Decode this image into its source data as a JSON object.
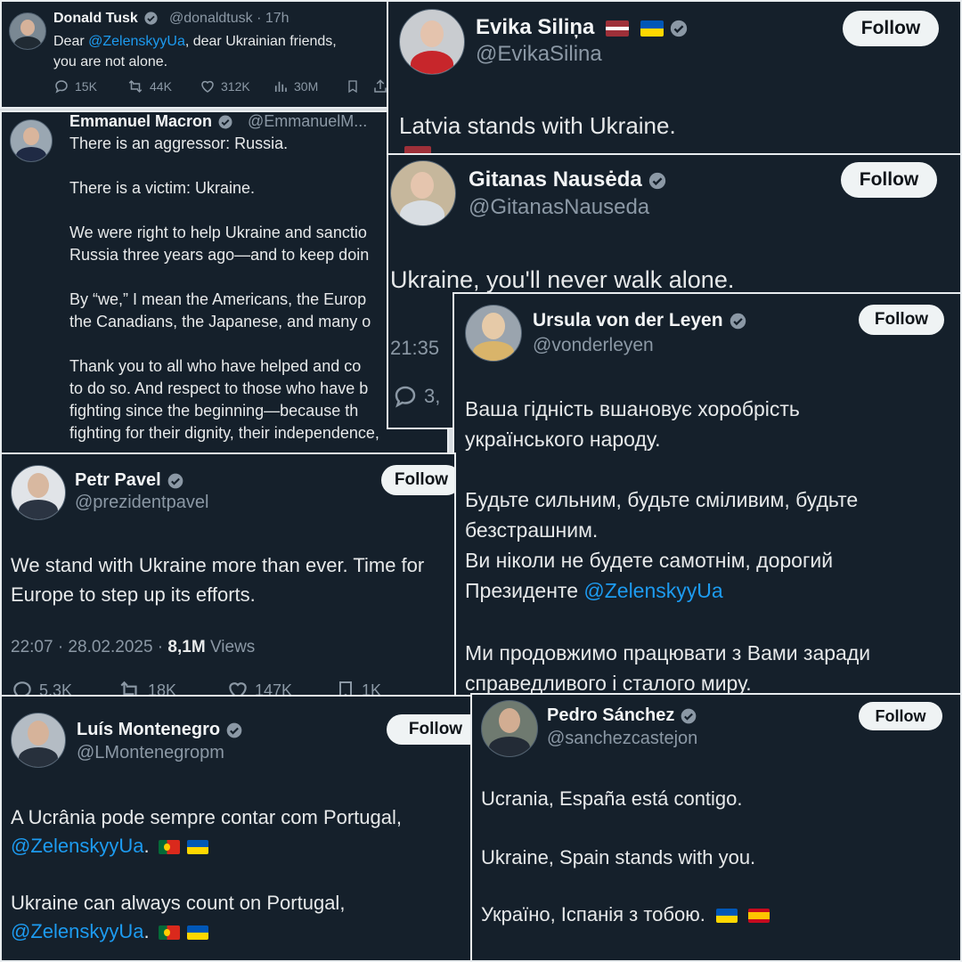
{
  "tusk": {
    "name": "Donald Tusk",
    "handle": "@donaldtusk · 17h",
    "text_before": "Dear ",
    "mention": "@ZelenskyyUa",
    "text_after": ", dear Ukrainian friends,\nyou are not alone.",
    "stats": {
      "replies": "15K",
      "reposts": "44K",
      "likes": "312K",
      "views": "30M"
    }
  },
  "silina": {
    "name": "Evika Siliņa",
    "handle": "@EvikaSilina",
    "follow": "Follow",
    "text": "Latvia stands with Ukraine.",
    "flags": [
      "latvia-flag",
      "ukraine-flag"
    ]
  },
  "nauseda": {
    "name": "Gitanas Nausėda",
    "handle": "@GitanasNauseda",
    "follow": "Follow",
    "text": "Ukraine, you'll never walk alone.",
    "time": "21:35",
    "replies": "3,"
  },
  "macron": {
    "name": "Emmanuel Macron",
    "handle": "@EmmanuelM...",
    "text": "There is an aggressor: Russia.\n\nThere is a victim: Ukraine.\n\nWe were right to help Ukraine and sanctio\nRussia three years ago—and to keep doin\n\nBy “we,” I mean the Americans, the Europ\nthe Canadians, the Japanese, and many o\n\nThank you to all who have helped and co\nto do so. And respect to those who have b\nfighting since the beginning—because th\nfighting for their dignity, their independence,"
  },
  "vonderleyen": {
    "name": "Ursula von der Leyen",
    "handle": "@vonderleyen",
    "follow": "Follow",
    "p1": "Ваша гідність вшановує хоробрість\nукраїнського народу.",
    "p2": "Будьте сильним, будьте сміливим, будьте\nбезстрашним.\nВи ніколи не будете самотнім, дорогий\nПрезиденте ",
    "mention": "@ZelenskyyUa",
    "p3": "Ми продовжимо працювати з Вами заради\nсправедливого і сталого  миру."
  },
  "pavel": {
    "name": "Petr Pavel",
    "handle": "@prezidentpavel",
    "follow": "Follow",
    "text": "We stand with Ukraine more than ever. Time for\nEurope to step up its efforts.",
    "date": "22:07 · 28.02.2025 · ",
    "views_count": "8,1M",
    "views_label": " Views",
    "stats": {
      "replies": "5,3K",
      "reposts": "18K",
      "likes": "147K",
      "bookmarks": "1K"
    }
  },
  "montenegro": {
    "name": "Luís Montenegro",
    "handle": "@LMontenegropm",
    "follow": "Follow",
    "pt_text": "A Ucrânia pode sempre contar com Portugal,",
    "en_text": "Ukraine can always count on Portugal,",
    "mention": "@ZelenskyyUa",
    "period": "."
  },
  "sanchez": {
    "name": "Pedro Sánchez",
    "handle": "@sanchezcastejon",
    "follow": "Follow",
    "line1": "Ucrania, España está contigo.",
    "line2": "Ukraine, Spain stands with you.",
    "line3": "Україно, Іспанія з тобою."
  },
  "colors": {
    "card_bg": "#15202b",
    "link": "#1d9bf0",
    "verified": "#8b98a5",
    "follow_bg": "#eff3f4"
  }
}
